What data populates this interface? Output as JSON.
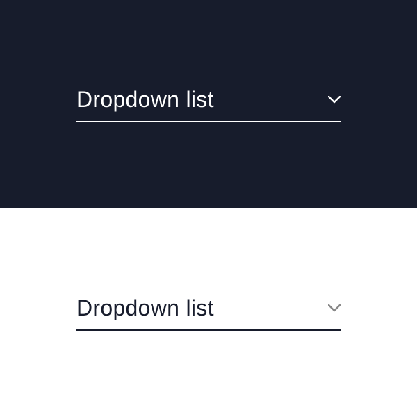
{
  "dropdowns": {
    "dark": {
      "label": "Dropdown list"
    },
    "light": {
      "label": "Dropdown list"
    }
  },
  "colors": {
    "dark_bg": "#171C2C",
    "light_bg": "#ffffff",
    "dark_text": "#ffffff",
    "light_text": "#171C2C",
    "light_chevron": "#888888"
  }
}
